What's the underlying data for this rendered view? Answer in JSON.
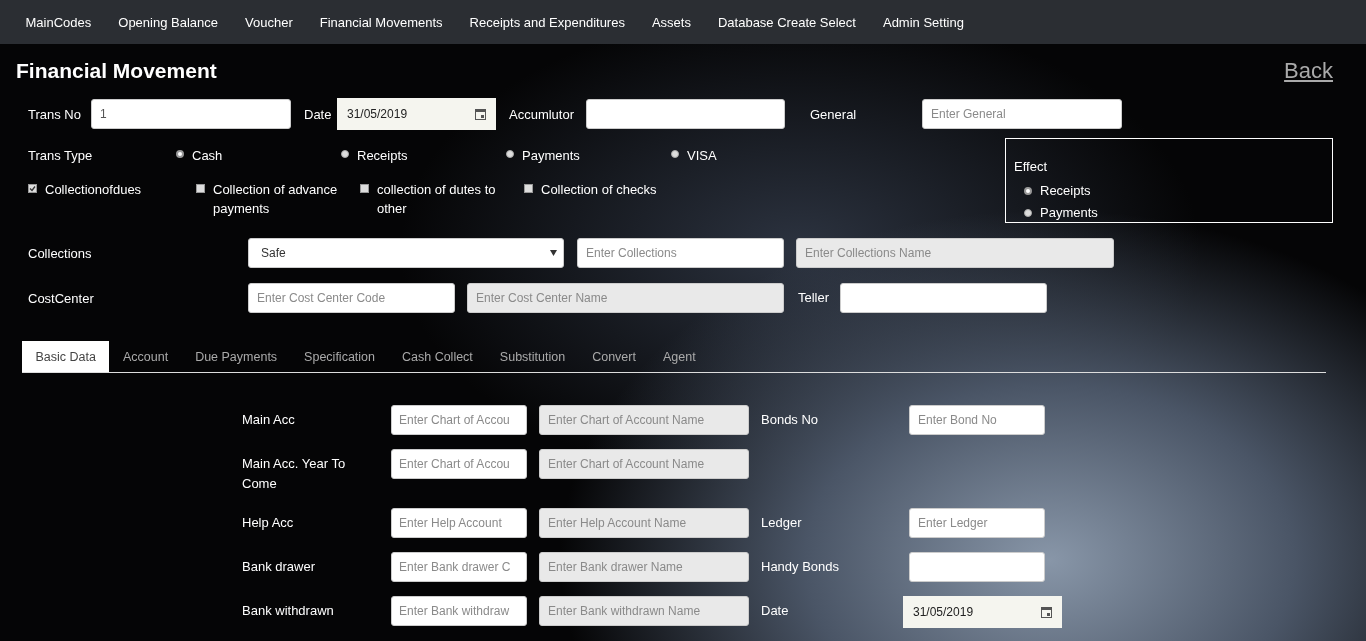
{
  "nav": {
    "items": [
      "MainCodes",
      "Opening Balance",
      "Voucher",
      "Financial Movements",
      "Receipts and Expenditures",
      "Assets",
      "Database Create Select",
      "Admin Setting"
    ]
  },
  "page": {
    "title": "Financial Movement",
    "back": "Back"
  },
  "header_fields": [
    {
      "label": "Trans No",
      "value": "1"
    },
    {
      "label": "Date",
      "date": "31/05/2019"
    },
    {
      "label": "Accumlutor"
    },
    {
      "label": "General",
      "placeholder": "Enter General"
    }
  ],
  "trans_type": {
    "label": "Trans Type",
    "options": [
      {
        "label": "Cash",
        "selected": true
      },
      {
        "label": "Receipts",
        "selected": false
      },
      {
        "label": "Payments",
        "selected": false
      },
      {
        "label": "VISA",
        "selected": false
      }
    ]
  },
  "collection_flags": [
    {
      "label": "Collectionofdues",
      "checked": true
    },
    {
      "label": "Collection of advance payments",
      "checked": false
    },
    {
      "label": "collection of dutes to other",
      "checked": false
    },
    {
      "label": "Collection of checks",
      "checked": false
    }
  ],
  "effect": {
    "title": "Effect",
    "options": [
      {
        "label": "Receipts",
        "selected": true
      },
      {
        "label": "Payments",
        "selected": false
      }
    ]
  },
  "collections": {
    "label": "Collections",
    "select": "Safe",
    "code_placeholder": "Enter Collections",
    "name_placeholder": "Enter Collections Name"
  },
  "cost_center": {
    "label": "CostCenter",
    "code_placeholder": "Enter Cost Center Code",
    "name_placeholder": "Enter Cost Center Name",
    "teller_label": "Teller"
  },
  "tabs": [
    {
      "label": "Basic Data",
      "selected": true
    },
    {
      "label": "Account",
      "selected": false
    },
    {
      "label": "Due Payments",
      "selected": false
    },
    {
      "label": "Specification",
      "selected": false
    },
    {
      "label": "Cash Collect",
      "selected": false
    },
    {
      "label": "Substitution",
      "selected": false
    },
    {
      "label": "Convert",
      "selected": false
    },
    {
      "label": "Agent",
      "selected": false
    }
  ],
  "basic_rows": [
    {
      "label": "Main Acc",
      "code_placeholder": "Enter Chart of Accou",
      "name_placeholder": "Enter Chart of Account Name",
      "side": {
        "label": "Bonds No",
        "placeholder": "Enter Bond No"
      }
    },
    {
      "label": "Main Acc. Year To Come",
      "code_placeholder": "Enter Chart of Accou",
      "name_placeholder": "Enter Chart of Account Name"
    },
    {
      "label": "Help Acc",
      "code_placeholder": "Enter Help Account",
      "name_placeholder": "Enter Help Account Name",
      "side": {
        "label": "Ledger",
        "placeholder": "Enter Ledger"
      }
    },
    {
      "label": "Bank drawer",
      "code_placeholder": "Enter Bank drawer C",
      "name_placeholder": "Enter Bank drawer Name",
      "side": {
        "label": "Handy Bonds"
      }
    },
    {
      "label": "Bank withdrawn",
      "code_placeholder": "Enter Bank withdraw",
      "name_placeholder": "Enter Bank withdrawn Name",
      "side": {
        "label": "Date",
        "date": "31/05/2019"
      }
    }
  ]
}
